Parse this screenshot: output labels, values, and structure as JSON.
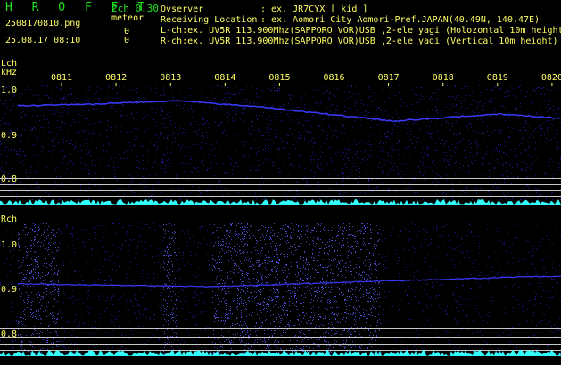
{
  "header": {
    "app_title": "H R O F F T",
    "mode": "2ch 0.30",
    "filename": "2508170810.png",
    "meteor_label": "meteor",
    "meteor_count_l": "0",
    "datetime": "25.08.17 08:10",
    "meteor_count_r": "0",
    "observer_label": "Ovserver",
    "observer_value": ": ex. JR7CYX [ kid ]",
    "location_label": "Receiving Location",
    "location_value": ": ex. Aomori City Aomori-Pref.JAPAN(40.49N, 140.47E)",
    "lch_info": "L-ch:ex. UV5R 113.900Mhz(SAPPORO VOR)USB ,2-ele yagi (Holozontal 10m height)",
    "rch_info": "R-ch:ex. UV5R 113.900Mhz(SAPPORO VOR)USB ,2-ele yagi (Vertical 10m height)"
  },
  "lch_panel": {
    "label": "Lch",
    "unit": "kHz",
    "y_ticks": [
      "1.0",
      "0.9",
      "0.8"
    ]
  },
  "rch_panel": {
    "label": "Rch",
    "y_ticks": [
      "1.0",
      "0.9",
      "0.8"
    ]
  },
  "time_ticks": [
    "0811",
    "0812",
    "0813",
    "0814",
    "0815",
    "0816",
    "0817",
    "0818",
    "0819",
    "0820"
  ],
  "colors": {
    "title_green": "#20e020",
    "text_yellow": "#ffff66",
    "axis_cyan": "#33ffff",
    "signal_blue": "#3a3aff",
    "noise_blue": "#1a1a8c",
    "guide_white": "#c8c8c8"
  }
}
